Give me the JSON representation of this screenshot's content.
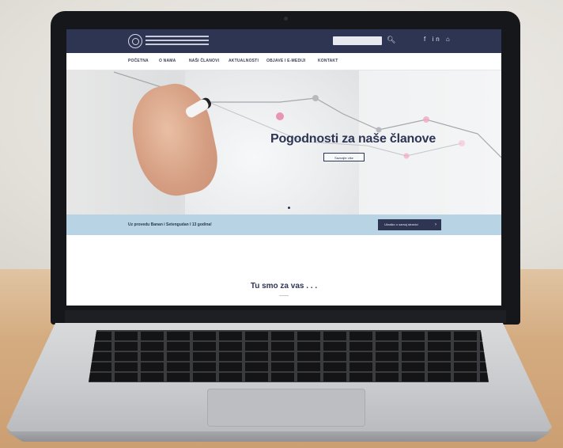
{
  "header": {
    "search_placeholder": "",
    "search_icon": "search-icon",
    "social": "f  in  ⌂"
  },
  "nav": {
    "items": [
      "POČETNA",
      "O NAMA",
      "NAŠI ČLANOVI",
      "AKTUALNOSTI",
      "OBJAVE I E-MEDIJI",
      "KONTAKT"
    ]
  },
  "hero": {
    "title": "Pogodnosti za naše članove",
    "button_label": "Saznajte više"
  },
  "band": {
    "text": "Uz provedu Banan i Setengudan I 13 godina!",
    "button_label": "Ukratko o samoj stranici",
    "button_icon": "chevron-right-icon"
  },
  "main": {
    "title": "Tu smo za vas . . ."
  },
  "colors": {
    "brand": "#2e3553",
    "band": "#b8d4e4"
  }
}
